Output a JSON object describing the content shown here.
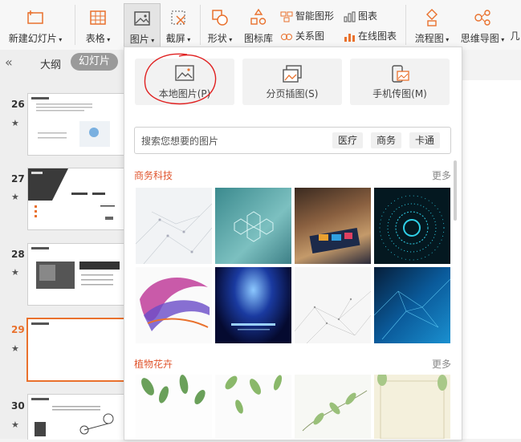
{
  "ribbon": {
    "new_slide": "新建幻灯片",
    "table": "表格",
    "picture": "图片",
    "screenshot": "截屏",
    "shape": "形状",
    "icon_lib": "图标库",
    "smart_shape": "智能图形",
    "chart": "图表",
    "relation": "关系图",
    "online_chart": "在线图表",
    "flowchart": "流程图",
    "mindmap": "思维导图",
    "more_cut": "几"
  },
  "panel": {
    "outline_tab": "大纲",
    "slides_tab": "幻灯片",
    "collapse": "«",
    "slides": [
      {
        "num": "26"
      },
      {
        "num": "27"
      },
      {
        "num": "28"
      },
      {
        "num": "29"
      },
      {
        "num": "30"
      }
    ]
  },
  "dropdown": {
    "local_pic": "本地图片(P)",
    "paged_pic": "分页插图(S)",
    "phone_pic": "手机传图(M)",
    "search_placeholder": "搜索您想要的图片",
    "tags": [
      "医疗",
      "商务",
      "卡通"
    ],
    "category1": "商务科技",
    "category2": "植物花卉",
    "more": "更多"
  },
  "colors": {
    "accent": "#e9712d",
    "category": "#e0562f",
    "annotation": "#e02020"
  }
}
